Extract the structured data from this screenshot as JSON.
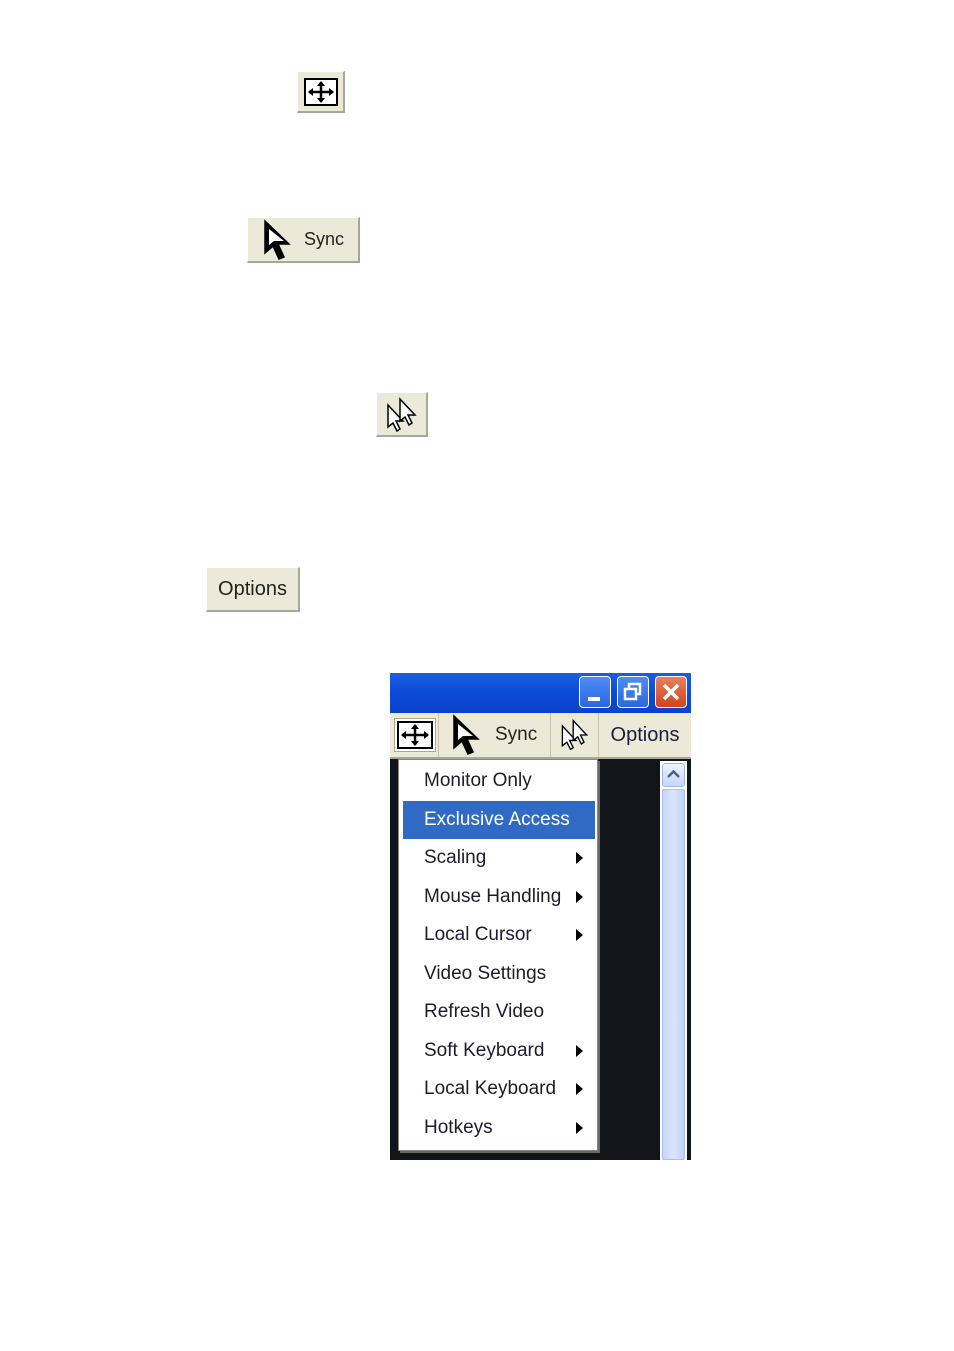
{
  "standalone_buttons": {
    "fit_icon": "fit-to-window-icon",
    "sync_label": "Sync",
    "sync_icon": "arrow-cursor-icon",
    "dual_cursor_icon": "dual-cursor-icon",
    "options_label": "Options"
  },
  "window": {
    "titlebar_buttons": [
      "minimize",
      "restore",
      "close"
    ],
    "toolbar": {
      "fit_icon": "fit-to-window-icon",
      "sync_label": "Sync",
      "dual_cursor_icon": "dual-cursor-icon",
      "options_label": "Options"
    },
    "menu": {
      "items": [
        {
          "label": "Monitor Only",
          "submenu": false,
          "selected": false
        },
        {
          "label": "Exclusive Access",
          "submenu": false,
          "selected": true
        },
        {
          "label": "Scaling",
          "submenu": true,
          "selected": false
        },
        {
          "label": "Mouse Handling",
          "submenu": true,
          "selected": false
        },
        {
          "label": "Local Cursor",
          "submenu": true,
          "selected": false
        },
        {
          "label": "Video Settings",
          "submenu": false,
          "selected": false
        },
        {
          "label": "Refresh Video",
          "submenu": false,
          "selected": false
        },
        {
          "label": "Soft Keyboard",
          "submenu": true,
          "selected": false
        },
        {
          "label": "Local Keyboard",
          "submenu": true,
          "selected": false
        },
        {
          "label": "Hotkeys",
          "submenu": true,
          "selected": false
        }
      ]
    },
    "colors": {
      "titlebar": "#0c4ad8",
      "selection": "#316ac5",
      "toolbar": "#ece9d8",
      "background": "#11151a"
    }
  }
}
